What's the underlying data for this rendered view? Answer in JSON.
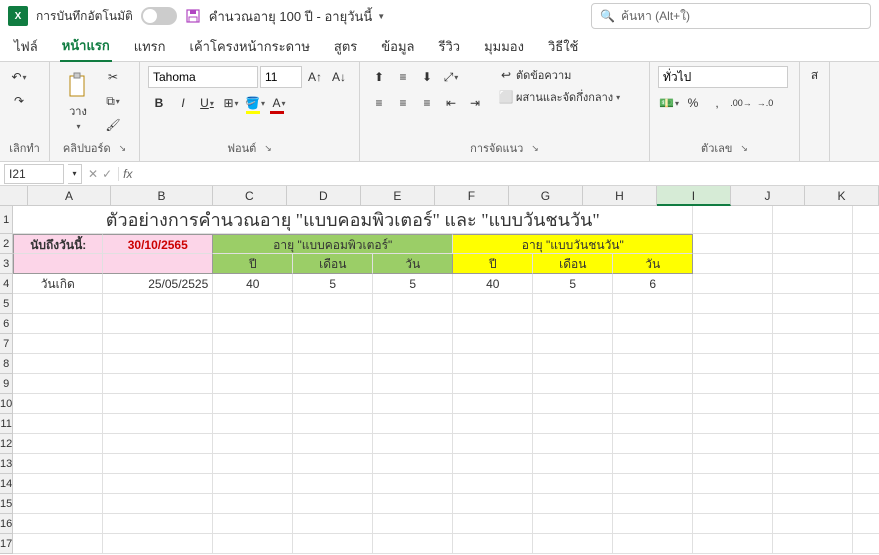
{
  "titlebar": {
    "autosave_label": "การบันทึกอัตโนมัติ",
    "filename": "คำนวณอายุ 100 ปี - อายุวันนี้",
    "search_placeholder": "ค้นหา (Alt+ใ)"
  },
  "tabs": {
    "file": "ไฟล์",
    "home": "หน้าแรก",
    "insert": "แทรก",
    "page_layout": "เค้าโครงหน้ากระดาษ",
    "formulas": "สูตร",
    "data": "ข้อมูล",
    "review": "รีวิว",
    "view": "มุมมอง",
    "help": "วิธีใช้"
  },
  "ribbon": {
    "undo": "เลิกทำ",
    "clipboard": "คลิปบอร์ด",
    "paste": "วาง",
    "font_group": "ฟอนต์",
    "font_name": "Tahoma",
    "font_size": "11",
    "alignment": "การจัดแนว",
    "wrap": "ตัดข้อความ",
    "merge": "ผสานและจัดกึ่งกลาง",
    "number": "ตัวเลข",
    "number_format": "ทั่วไป",
    "styles": "ส"
  },
  "formula_bar": {
    "name_box": "I21",
    "fx": "fx"
  },
  "columns": [
    "A",
    "B",
    "C",
    "D",
    "E",
    "F",
    "G",
    "H",
    "I",
    "J",
    "K"
  ],
  "rows": [
    "1",
    "2",
    "3",
    "4",
    "5",
    "6",
    "7",
    "8",
    "9",
    "10",
    "11",
    "12",
    "13",
    "14",
    "15",
    "16",
    "17"
  ],
  "sheet": {
    "title": "ตัวอย่างการคำนวณอายุ \"แบบคอมพิวเตอร์\" และ \"แบบวันชนวัน\"",
    "a2": "นับถึงวันนี้:",
    "b2": "30/10/2565",
    "comp_header": "อายุ \"แบบคอมพิวเตอร์\"",
    "human_header": "อายุ \"แบบวันชนวัน\"",
    "year": "ปี",
    "month": "เดือน",
    "day": "วัน",
    "a4": "วันเกิด",
    "b4": "25/05/2525",
    "c4": "40",
    "d4": "5",
    "e4": "5",
    "f4": "40",
    "g4": "5",
    "h4": "6"
  }
}
